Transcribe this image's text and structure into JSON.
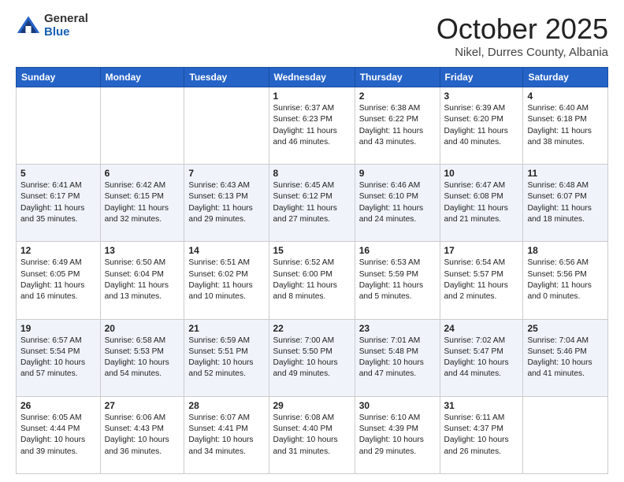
{
  "logo": {
    "general": "General",
    "blue": "Blue"
  },
  "header": {
    "month": "October 2025",
    "location": "Nikel, Durres County, Albania"
  },
  "days_of_week": [
    "Sunday",
    "Monday",
    "Tuesday",
    "Wednesday",
    "Thursday",
    "Friday",
    "Saturday"
  ],
  "weeks": [
    [
      {
        "day": "",
        "info": ""
      },
      {
        "day": "",
        "info": ""
      },
      {
        "day": "",
        "info": ""
      },
      {
        "day": "1",
        "info": "Sunrise: 6:37 AM\nSunset: 6:23 PM\nDaylight: 11 hours and 46 minutes."
      },
      {
        "day": "2",
        "info": "Sunrise: 6:38 AM\nSunset: 6:22 PM\nDaylight: 11 hours and 43 minutes."
      },
      {
        "day": "3",
        "info": "Sunrise: 6:39 AM\nSunset: 6:20 PM\nDaylight: 11 hours and 40 minutes."
      },
      {
        "day": "4",
        "info": "Sunrise: 6:40 AM\nSunset: 6:18 PM\nDaylight: 11 hours and 38 minutes."
      }
    ],
    [
      {
        "day": "5",
        "info": "Sunrise: 6:41 AM\nSunset: 6:17 PM\nDaylight: 11 hours and 35 minutes."
      },
      {
        "day": "6",
        "info": "Sunrise: 6:42 AM\nSunset: 6:15 PM\nDaylight: 11 hours and 32 minutes."
      },
      {
        "day": "7",
        "info": "Sunrise: 6:43 AM\nSunset: 6:13 PM\nDaylight: 11 hours and 29 minutes."
      },
      {
        "day": "8",
        "info": "Sunrise: 6:45 AM\nSunset: 6:12 PM\nDaylight: 11 hours and 27 minutes."
      },
      {
        "day": "9",
        "info": "Sunrise: 6:46 AM\nSunset: 6:10 PM\nDaylight: 11 hours and 24 minutes."
      },
      {
        "day": "10",
        "info": "Sunrise: 6:47 AM\nSunset: 6:08 PM\nDaylight: 11 hours and 21 minutes."
      },
      {
        "day": "11",
        "info": "Sunrise: 6:48 AM\nSunset: 6:07 PM\nDaylight: 11 hours and 18 minutes."
      }
    ],
    [
      {
        "day": "12",
        "info": "Sunrise: 6:49 AM\nSunset: 6:05 PM\nDaylight: 11 hours and 16 minutes."
      },
      {
        "day": "13",
        "info": "Sunrise: 6:50 AM\nSunset: 6:04 PM\nDaylight: 11 hours and 13 minutes."
      },
      {
        "day": "14",
        "info": "Sunrise: 6:51 AM\nSunset: 6:02 PM\nDaylight: 11 hours and 10 minutes."
      },
      {
        "day": "15",
        "info": "Sunrise: 6:52 AM\nSunset: 6:00 PM\nDaylight: 11 hours and 8 minutes."
      },
      {
        "day": "16",
        "info": "Sunrise: 6:53 AM\nSunset: 5:59 PM\nDaylight: 11 hours and 5 minutes."
      },
      {
        "day": "17",
        "info": "Sunrise: 6:54 AM\nSunset: 5:57 PM\nDaylight: 11 hours and 2 minutes."
      },
      {
        "day": "18",
        "info": "Sunrise: 6:56 AM\nSunset: 5:56 PM\nDaylight: 11 hours and 0 minutes."
      }
    ],
    [
      {
        "day": "19",
        "info": "Sunrise: 6:57 AM\nSunset: 5:54 PM\nDaylight: 10 hours and 57 minutes."
      },
      {
        "day": "20",
        "info": "Sunrise: 6:58 AM\nSunset: 5:53 PM\nDaylight: 10 hours and 54 minutes."
      },
      {
        "day": "21",
        "info": "Sunrise: 6:59 AM\nSunset: 5:51 PM\nDaylight: 10 hours and 52 minutes."
      },
      {
        "day": "22",
        "info": "Sunrise: 7:00 AM\nSunset: 5:50 PM\nDaylight: 10 hours and 49 minutes."
      },
      {
        "day": "23",
        "info": "Sunrise: 7:01 AM\nSunset: 5:48 PM\nDaylight: 10 hours and 47 minutes."
      },
      {
        "day": "24",
        "info": "Sunrise: 7:02 AM\nSunset: 5:47 PM\nDaylight: 10 hours and 44 minutes."
      },
      {
        "day": "25",
        "info": "Sunrise: 7:04 AM\nSunset: 5:46 PM\nDaylight: 10 hours and 41 minutes."
      }
    ],
    [
      {
        "day": "26",
        "info": "Sunrise: 6:05 AM\nSunset: 4:44 PM\nDaylight: 10 hours and 39 minutes."
      },
      {
        "day": "27",
        "info": "Sunrise: 6:06 AM\nSunset: 4:43 PM\nDaylight: 10 hours and 36 minutes."
      },
      {
        "day": "28",
        "info": "Sunrise: 6:07 AM\nSunset: 4:41 PM\nDaylight: 10 hours and 34 minutes."
      },
      {
        "day": "29",
        "info": "Sunrise: 6:08 AM\nSunset: 4:40 PM\nDaylight: 10 hours and 31 minutes."
      },
      {
        "day": "30",
        "info": "Sunrise: 6:10 AM\nSunset: 4:39 PM\nDaylight: 10 hours and 29 minutes."
      },
      {
        "day": "31",
        "info": "Sunrise: 6:11 AM\nSunset: 4:37 PM\nDaylight: 10 hours and 26 minutes."
      },
      {
        "day": "",
        "info": ""
      }
    ]
  ]
}
